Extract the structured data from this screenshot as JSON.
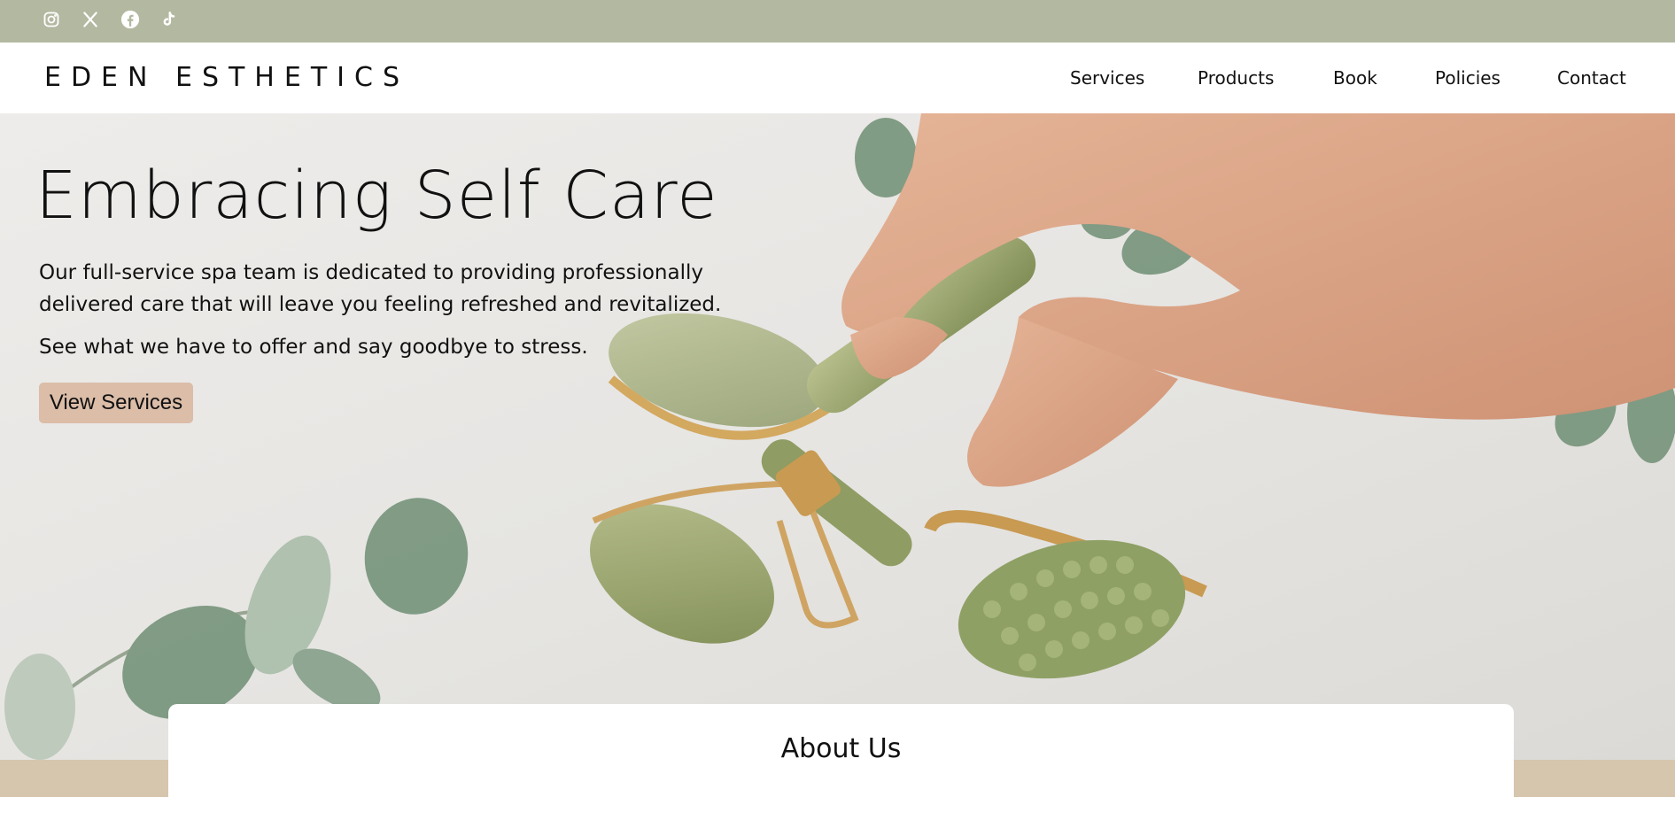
{
  "social": {
    "icons": [
      "instagram-icon",
      "x-icon",
      "facebook-icon",
      "tiktok-icon"
    ]
  },
  "brand": {
    "name": "EDEN ESTHETICS"
  },
  "nav": {
    "items": [
      {
        "label": "Services"
      },
      {
        "label": "Products"
      },
      {
        "label": "Book"
      },
      {
        "label": "Policies"
      },
      {
        "label": "Contact"
      }
    ]
  },
  "hero": {
    "title": "Embracing Self Care",
    "paragraph_1": "Our full-service spa team is dedicated to providing professionally delivered care that will leave you feeling refreshed and revitalized.",
    "paragraph_2": "See what we have to offer and say goodbye to stress.",
    "button_label": "View Services"
  },
  "about": {
    "title": "About Us"
  },
  "colors": {
    "topbar": "#b3b8a1",
    "button": "#dbbda8",
    "band": "#d6c6ad"
  }
}
